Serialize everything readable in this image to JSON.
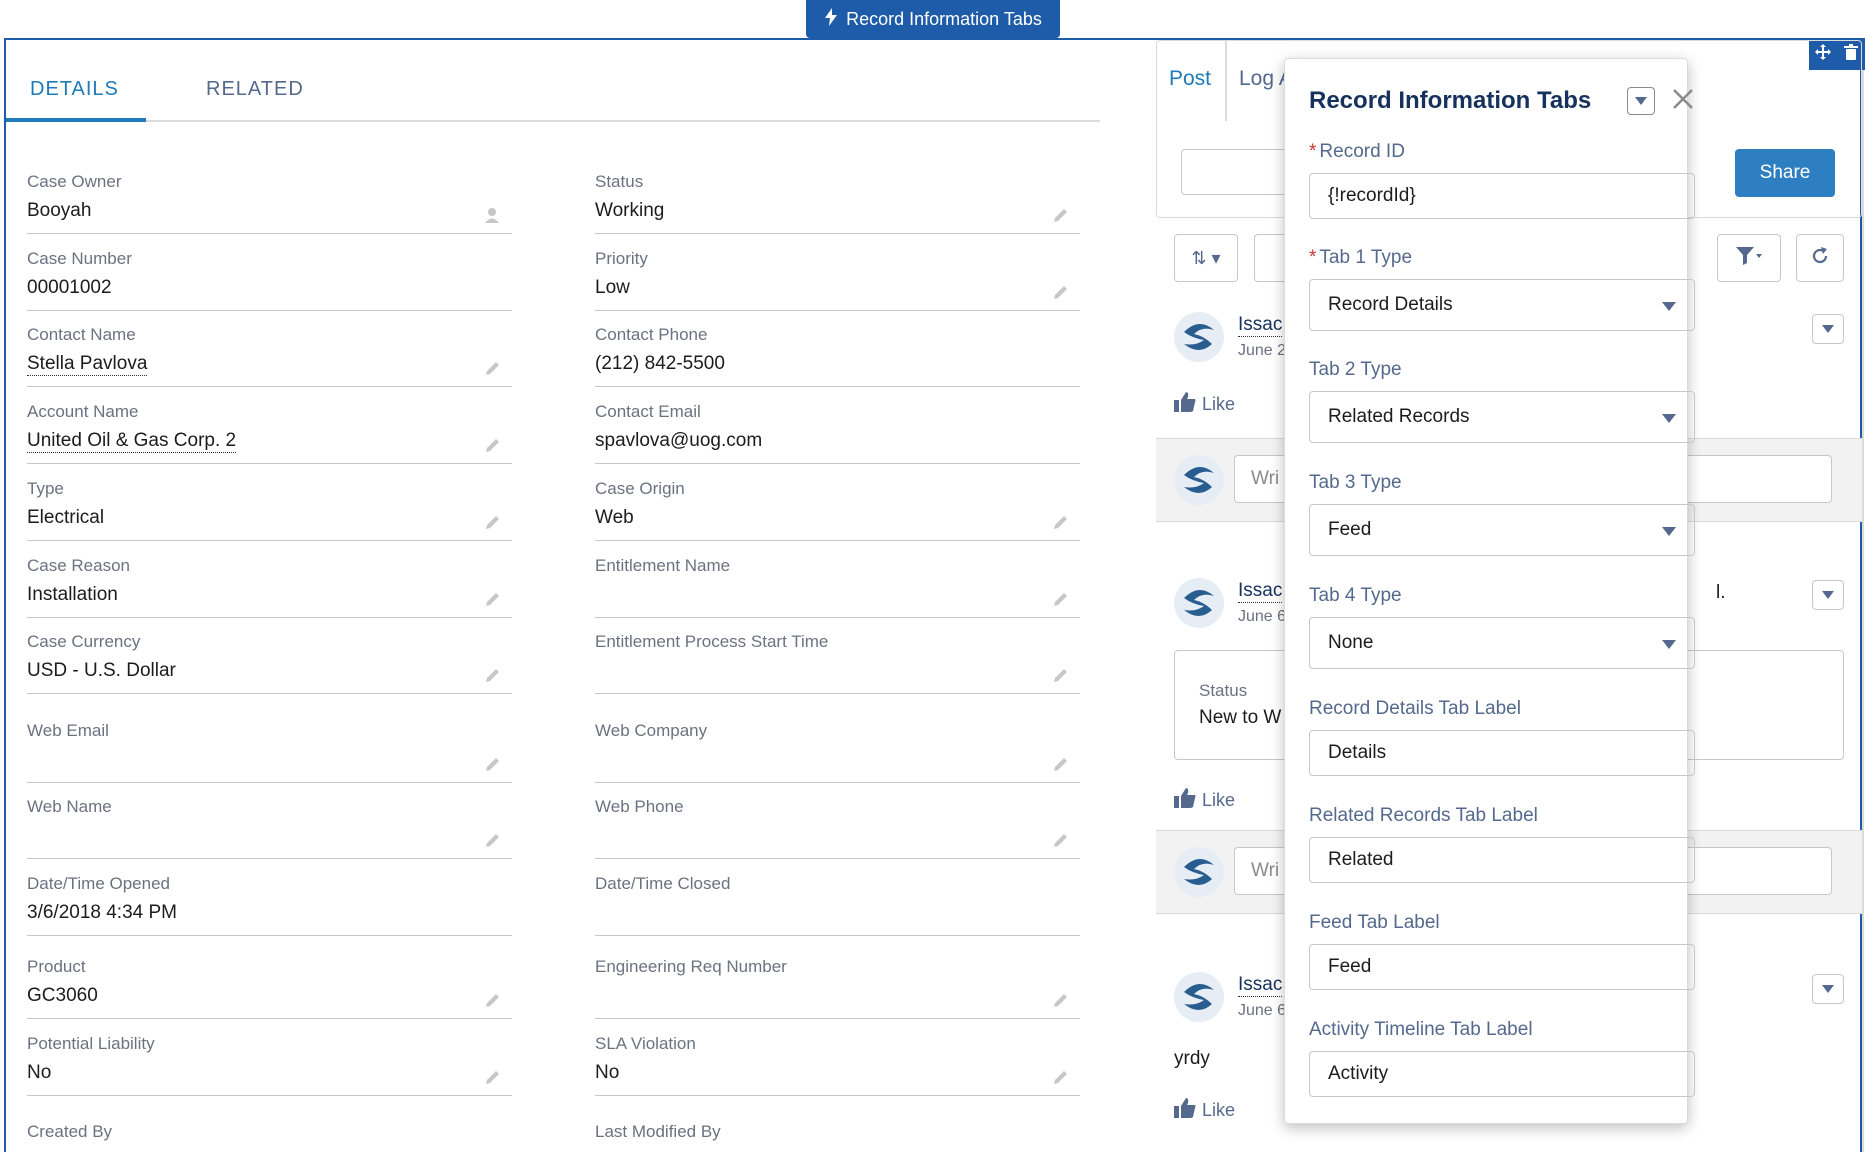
{
  "component_badge": {
    "label": "Record Information Tabs"
  },
  "tabs": [
    {
      "label": "DETAILS",
      "active": true
    },
    {
      "label": "RELATED",
      "active": false
    }
  ],
  "fields_left": [
    {
      "label": "Case Owner",
      "value": "Booyah",
      "link": false,
      "icon": "change-owner-icon"
    },
    {
      "label": "Case Number",
      "value": "00001002",
      "link": false,
      "icon": ""
    },
    {
      "label": "Contact Name",
      "value": "Stella Pavlova",
      "link": true,
      "icon": "edit-pencil-icon"
    },
    {
      "label": "Account Name",
      "value": "United Oil & Gas Corp. 2",
      "link": true,
      "icon": "edit-pencil-icon"
    },
    {
      "label": "Type",
      "value": "Electrical",
      "link": false,
      "icon": "edit-pencil-icon"
    },
    {
      "label": "Case Reason",
      "value": "Installation",
      "link": false,
      "icon": "edit-pencil-icon"
    },
    {
      "label": "Case Currency",
      "value": "USD - U.S. Dollar",
      "link": false,
      "icon": "edit-pencil-icon"
    },
    {
      "label": "Web Email",
      "value": "",
      "link": false,
      "icon": "edit-pencil-icon"
    },
    {
      "label": "Web Name",
      "value": "",
      "link": false,
      "icon": "edit-pencil-icon"
    },
    {
      "label": "Date/Time Opened",
      "value": "3/6/2018 4:34 PM",
      "link": false,
      "icon": ""
    },
    {
      "label": "Product",
      "value": "GC3060",
      "link": false,
      "icon": "edit-pencil-icon"
    },
    {
      "label": "Potential Liability",
      "value": "No",
      "link": false,
      "icon": "edit-pencil-icon"
    },
    {
      "label": "Created By",
      "value": "",
      "link": false,
      "icon": ""
    }
  ],
  "fields_right": [
    {
      "label": "Status",
      "value": "Working",
      "link": false,
      "icon": "edit-pencil-icon"
    },
    {
      "label": "Priority",
      "value": "Low",
      "link": false,
      "icon": "edit-pencil-icon"
    },
    {
      "label": "Contact Phone",
      "value": "(212) 842-5500",
      "link": false,
      "icon": ""
    },
    {
      "label": "Contact Email",
      "value": "spavlova@uog.com",
      "link": false,
      "icon": ""
    },
    {
      "label": "Case Origin",
      "value": "Web",
      "link": false,
      "icon": "edit-pencil-icon"
    },
    {
      "label": "Entitlement Name",
      "value": "",
      "link": false,
      "icon": "edit-pencil-icon"
    },
    {
      "label": "Entitlement Process Start Time",
      "value": "",
      "link": false,
      "icon": "edit-pencil-icon"
    },
    {
      "label": "Web Company",
      "value": "",
      "link": false,
      "icon": "edit-pencil-icon"
    },
    {
      "label": "Web Phone",
      "value": "",
      "link": false,
      "icon": "edit-pencil-icon"
    },
    {
      "label": "Date/Time Closed",
      "value": "",
      "link": false,
      "icon": ""
    },
    {
      "label": "Engineering Req Number",
      "value": "",
      "link": false,
      "icon": "edit-pencil-icon"
    },
    {
      "label": "SLA Violation",
      "value": "No",
      "link": false,
      "icon": "edit-pencil-icon"
    },
    {
      "label": "Last Modified By",
      "value": "",
      "link": false,
      "icon": ""
    }
  ],
  "feed": {
    "post_tab": "Post",
    "log_tab": "Log A",
    "share_label": "Share",
    "posts": [
      {
        "name": "Issac",
        "date": "June 2"
      },
      {
        "name": "Issac",
        "date": "June 6"
      },
      {
        "name": "Issac",
        "date": "June 6"
      }
    ],
    "like_label": "Like",
    "comment_placeholder": "Wri",
    "status_label": "Status",
    "status_value": "New to W",
    "post_body": "yrdy",
    "stray_text": "l."
  },
  "popover": {
    "title": "Record Information Tabs",
    "record_id_label": "Record ID",
    "record_id_value": "{!recordId}",
    "tab1_label": "Tab 1 Type",
    "tab1_value": "Record Details",
    "tab2_label": "Tab 2 Type",
    "tab2_value": "Related Records",
    "tab3_label": "Tab 3 Type",
    "tab3_value": "Feed",
    "tab4_label": "Tab 4 Type",
    "tab4_value": "None",
    "details_label": "Record Details Tab Label",
    "details_value": "Details",
    "related_label": "Related Records Tab Label",
    "related_value": "Related",
    "feed_label": "Feed Tab Label",
    "feed_value": "Feed",
    "activity_label": "Activity Timeline Tab Label",
    "activity_value": "Activity"
  },
  "colors": {
    "accent": "#1e5ba8",
    "link": "#1e7ab8",
    "required": "#c23934"
  }
}
